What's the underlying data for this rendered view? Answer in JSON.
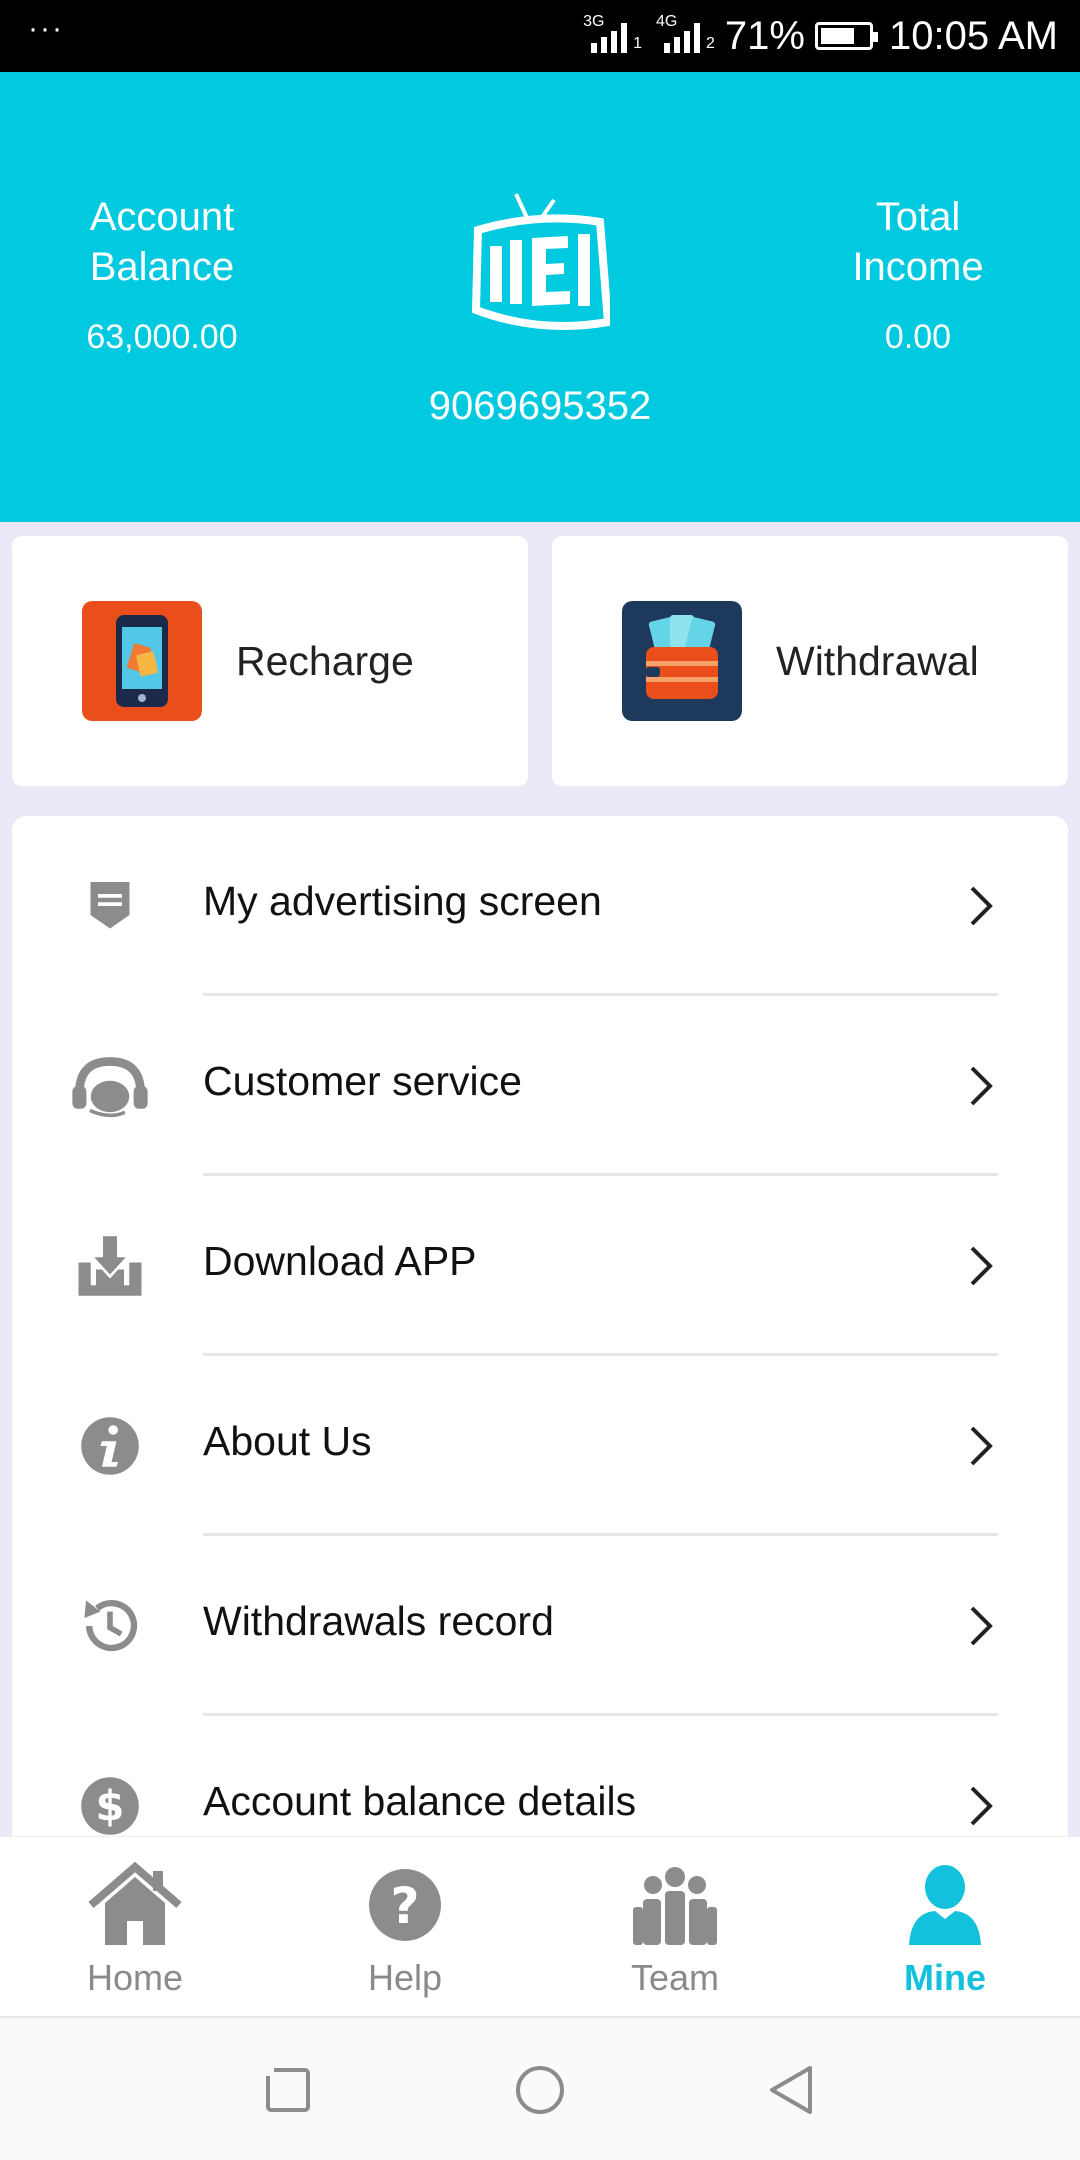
{
  "status_bar": {
    "dots": "···",
    "net1": "3G",
    "sim1": "1",
    "net2": "4G",
    "sim2": "2",
    "battery": "71%",
    "time": "10:05 AM"
  },
  "header": {
    "balance_label": "Account Balance",
    "balance_value": "63,000.00",
    "income_label": "Total Income",
    "income_value": "0.00",
    "phone": "9069695352",
    "bg_color": "#00c9e0"
  },
  "actions": {
    "recharge": "Recharge",
    "withdrawal": "Withdrawal"
  },
  "menu": [
    {
      "label": "My advertising screen",
      "icon": "screen-icon"
    },
    {
      "label": "Customer service",
      "icon": "headset-icon"
    },
    {
      "label": "Download APP",
      "icon": "download-tray-icon"
    },
    {
      "label": "About Us",
      "icon": "info-icon"
    },
    {
      "label": "Withdrawals record",
      "icon": "history-icon"
    },
    {
      "label": "Account balance details",
      "icon": "dollar-icon"
    }
  ],
  "tabs": [
    {
      "label": "Home",
      "icon": "home-icon"
    },
    {
      "label": "Help",
      "icon": "help-icon"
    },
    {
      "label": "Team",
      "icon": "team-icon"
    },
    {
      "label": "Mine",
      "icon": "user-icon",
      "active": true
    }
  ],
  "accent_color": "#13c1dd"
}
